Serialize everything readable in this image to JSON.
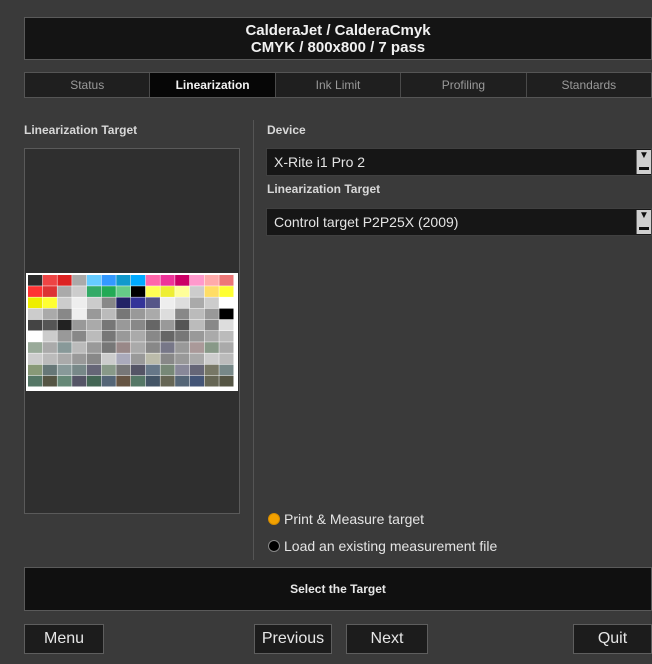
{
  "header": {
    "line1": "CalderaJet / CalderaCmyk",
    "line2": "CMYK / 800x800 / 7 pass"
  },
  "tabs": [
    {
      "label": "Status",
      "active": false
    },
    {
      "label": "Linearization",
      "active": true
    },
    {
      "label": "Ink Limit",
      "active": false
    },
    {
      "label": "Profiling",
      "active": false
    },
    {
      "label": "Standards",
      "active": false
    }
  ],
  "left_panel": {
    "title": "Linearization Target"
  },
  "device": {
    "label": "Device",
    "value": "X-Rite i1 Pro 2"
  },
  "linearization_target": {
    "label": "Linearization Target",
    "value": "Control target P2P25X (2009)"
  },
  "options": {
    "print_measure": "Print & Measure target",
    "load_file": "Load an existing measurement file",
    "selected": "print_measure"
  },
  "status": {
    "message": "Select the Target"
  },
  "buttons": {
    "menu": "Menu",
    "previous": "Previous",
    "next": "Next",
    "quit": "Quit"
  },
  "colors": {
    "accent_radio": "#f2a100",
    "background": "#3a3a3a"
  }
}
